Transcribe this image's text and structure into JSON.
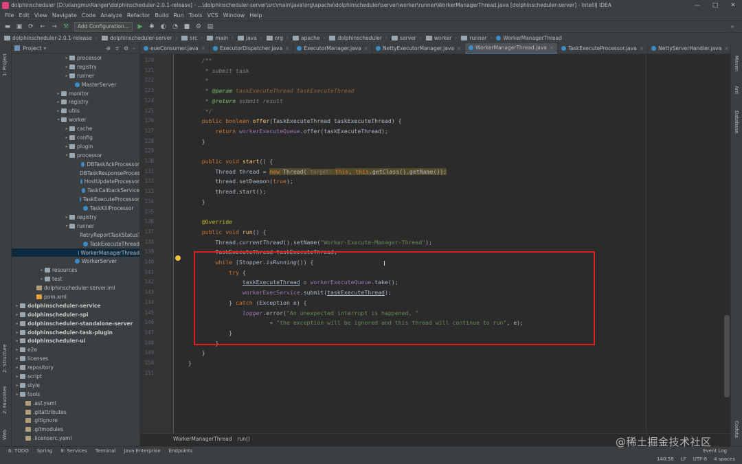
{
  "window": {
    "title": "dolphinscheduler [D:\\xiangmu\\Ranger\\dolphinscheduler-2.0.1-release] - ...\\dolphinscheduler-server\\src\\main\\java\\org\\apache\\dolphinscheduler\\server\\worker\\runner\\WorkerManagerThread.java [dolphinscheduler-server] - IntelliJ IDEA",
    "controls": [
      "—",
      "□",
      "✕"
    ]
  },
  "menu": [
    "File",
    "Edit",
    "View",
    "Navigate",
    "Code",
    "Analyze",
    "Refactor",
    "Build",
    "Run",
    "Tools",
    "VCS",
    "Window",
    "Help"
  ],
  "toolbar": {
    "config_label": "Add Configuration..."
  },
  "breadcrumb": [
    "dolphinscheduler-2.0.1-release",
    "dolphinscheduler-server",
    "src",
    "main",
    "java",
    "org",
    "apache",
    "dolphinscheduler",
    "server",
    "worker",
    "runner",
    "WorkerManagerThread"
  ],
  "side": {
    "project": "1: Project",
    "structure": "2: Structure",
    "favorites": "2: Favorites",
    "web": "Web",
    "maven": "Maven",
    "ant": "Ant",
    "database": "Database",
    "codota": "Codota"
  },
  "project": {
    "header": "Project",
    "tree": [
      {
        "label": "processor",
        "indent": 76,
        "icon": "folder",
        "arrow": "▸"
      },
      {
        "label": "registry",
        "indent": 76,
        "icon": "folder",
        "arrow": "▸"
      },
      {
        "label": "runner",
        "indent": 76,
        "icon": "folder",
        "arrow": "▸"
      },
      {
        "label": "MasterServer",
        "indent": 84,
        "icon": "cls",
        "arrow": ""
      },
      {
        "label": "monitor",
        "indent": 64,
        "icon": "folder",
        "arrow": "▸"
      },
      {
        "label": "registry",
        "indent": 64,
        "icon": "folder",
        "arrow": "▸"
      },
      {
        "label": "utils",
        "indent": 64,
        "icon": "folder",
        "arrow": "▸"
      },
      {
        "label": "worker",
        "indent": 64,
        "icon": "folder",
        "arrow": "▾"
      },
      {
        "label": "cache",
        "indent": 76,
        "icon": "folder",
        "arrow": "▸"
      },
      {
        "label": "config",
        "indent": 76,
        "icon": "folder",
        "arrow": "▸"
      },
      {
        "label": "plugin",
        "indent": 76,
        "icon": "folder",
        "arrow": "▸"
      },
      {
        "label": "processor",
        "indent": 76,
        "icon": "folder",
        "arrow": "▾"
      },
      {
        "label": "DBTaskAckProcessor",
        "indent": 96,
        "icon": "cls",
        "arrow": ""
      },
      {
        "label": "DBTaskResponseProcessor",
        "indent": 96,
        "icon": "cls",
        "arrow": ""
      },
      {
        "label": "HostUpdateProcessor",
        "indent": 96,
        "icon": "cls",
        "arrow": ""
      },
      {
        "label": "TaskCallbackService",
        "indent": 96,
        "icon": "cls",
        "arrow": ""
      },
      {
        "label": "TaskExecuteProcessor",
        "indent": 96,
        "icon": "cls",
        "arrow": ""
      },
      {
        "label": "TaskKillProcessor",
        "indent": 96,
        "icon": "cls",
        "arrow": ""
      },
      {
        "label": "registry",
        "indent": 76,
        "icon": "folder",
        "arrow": "▸"
      },
      {
        "label": "runner",
        "indent": 76,
        "icon": "folder",
        "arrow": "▾"
      },
      {
        "label": "RetryReportTaskStatusThread",
        "indent": 96,
        "icon": "cls",
        "arrow": ""
      },
      {
        "label": "TaskExecuteThread",
        "indent": 96,
        "icon": "cls",
        "arrow": ""
      },
      {
        "label": "WorkerManagerThread",
        "indent": 96,
        "icon": "cls",
        "arrow": "",
        "selected": true
      },
      {
        "label": "WorkerServer",
        "indent": 84,
        "icon": "cls",
        "arrow": ""
      },
      {
        "label": "resources",
        "indent": 40,
        "icon": "folder",
        "arrow": "▸"
      },
      {
        "label": "test",
        "indent": 40,
        "icon": "folder",
        "arrow": "▸"
      },
      {
        "label": "dolphinscheduler-server.iml",
        "indent": 28,
        "icon": "file",
        "arrow": ""
      },
      {
        "label": "pom.xml",
        "indent": 28,
        "icon": "xml",
        "arrow": ""
      },
      {
        "label": "dolphinscheduler-service",
        "indent": 4,
        "icon": "folder",
        "arrow": "▸",
        "bold": true
      },
      {
        "label": "dolphinscheduler-spi",
        "indent": 4,
        "icon": "folder",
        "arrow": "▸",
        "bold": true
      },
      {
        "label": "dolphinscheduler-standalone-server",
        "indent": 4,
        "icon": "folder",
        "arrow": "▸",
        "bold": true
      },
      {
        "label": "dolphinscheduler-task-plugin",
        "indent": 4,
        "icon": "folder",
        "arrow": "▸",
        "bold": true
      },
      {
        "label": "dolphinscheduler-ui",
        "indent": 4,
        "icon": "folder",
        "arrow": "▸",
        "bold": true
      },
      {
        "label": "e2e",
        "indent": 4,
        "icon": "folder",
        "arrow": "▸"
      },
      {
        "label": "licenses",
        "indent": 4,
        "icon": "folder",
        "arrow": "▸"
      },
      {
        "label": "repository",
        "indent": 4,
        "icon": "folder",
        "arrow": "▸"
      },
      {
        "label": "script",
        "indent": 4,
        "icon": "folder",
        "arrow": "▸"
      },
      {
        "label": "style",
        "indent": 4,
        "icon": "folder",
        "arrow": "▸"
      },
      {
        "label": "tools",
        "indent": 4,
        "icon": "folder",
        "arrow": "▸"
      },
      {
        "label": ".asf.yaml",
        "indent": 12,
        "icon": "file",
        "arrow": ""
      },
      {
        "label": ".gitattributes",
        "indent": 12,
        "icon": "file",
        "arrow": ""
      },
      {
        "label": ".gitignore",
        "indent": 12,
        "icon": "file",
        "arrow": ""
      },
      {
        "label": ".gitmodules",
        "indent": 12,
        "icon": "file",
        "arrow": ""
      },
      {
        "label": ".licenserc.yaml",
        "indent": 12,
        "icon": "file",
        "arrow": ""
      }
    ]
  },
  "tabs": [
    {
      "label": "eueConsumer.java"
    },
    {
      "label": "ExecutorDispatcher.java"
    },
    {
      "label": "ExecutorManager.java"
    },
    {
      "label": "NettyExecutorManager.java"
    },
    {
      "label": "WorkerManagerThread.java",
      "active": true
    },
    {
      "label": "TaskExecuteProcessor.java"
    },
    {
      "label": "NettyServerHandler.java"
    }
  ],
  "line_numbers": [
    "120",
    "121",
    "122",
    "123",
    "124",
    "125",
    "126",
    "127",
    "128",
    "129",
    "130",
    "131",
    "132",
    "133",
    "134",
    "135",
    "136",
    "137",
    "138",
    "139",
    "140",
    "141",
    "142",
    "143",
    "144",
    "145",
    "146",
    "147",
    "148",
    "149",
    "150",
    "151"
  ],
  "code_lines": [
    [
      {
        "t": "    /**",
        "c": "cm"
      }
    ],
    [
      {
        "t": "     * submit task",
        "c": "cm"
      }
    ],
    [
      {
        "t": "     *",
        "c": "cm"
      }
    ],
    [
      {
        "t": "     * ",
        "c": "cm"
      },
      {
        "t": "@param",
        "c": "tag"
      },
      {
        "t": " taskExecuteThread taskExecuteThread",
        "c": "prm"
      }
    ],
    [
      {
        "t": "     * ",
        "c": "cm"
      },
      {
        "t": "@return",
        "c": "tag"
      },
      {
        "t": " submit result",
        "c": "cm"
      }
    ],
    [
      {
        "t": "     */",
        "c": "cm"
      }
    ],
    [
      {
        "t": "    public boolean ",
        "c": "kw"
      },
      {
        "t": "offer",
        "c": "fn"
      },
      {
        "t": "(TaskExecuteThread taskExecuteThread) {"
      }
    ],
    [
      {
        "t": "        return ",
        "c": "kw"
      },
      {
        "t": "workerExecuteQueue",
        "c": "fld"
      },
      {
        "t": ".offer(taskExecuteThread);"
      }
    ],
    [
      {
        "t": "    }"
      }
    ],
    [
      {
        "t": ""
      }
    ],
    [
      {
        "t": "    public void ",
        "c": "kw"
      },
      {
        "t": "start",
        "c": "fn"
      },
      {
        "t": "() {"
      }
    ],
    [
      {
        "t": "        Thread thread = "
      },
      {
        "t": "new",
        "c": "kw hl"
      },
      {
        "t": " Thread( ",
        "c": "hl"
      },
      {
        "t": "target: ",
        "c": "hint hl"
      },
      {
        "t": "this",
        "c": "kw hl"
      },
      {
        "t": ", ",
        "c": "hl"
      },
      {
        "t": "this",
        "c": "kw hl"
      },
      {
        "t": ".getClass().getName());",
        "c": "hl"
      }
    ],
    [
      {
        "t": "        thread.setDaemon("
      },
      {
        "t": "true",
        "c": "kw"
      },
      {
        "t": ");"
      }
    ],
    [
      {
        "t": "        thread.start();"
      }
    ],
    [
      {
        "t": "    }"
      }
    ],
    [
      {
        "t": ""
      }
    ],
    [
      {
        "t": "    @Override",
        "c": "ann"
      }
    ],
    [
      {
        "t": "    public void ",
        "c": "kw"
      },
      {
        "t": "run",
        "c": "fn"
      },
      {
        "t": "() {"
      }
    ],
    [
      {
        "t": "        Thread."
      },
      {
        "t": "currentThread",
        "c": "ital"
      },
      {
        "t": "().setName("
      },
      {
        "t": "\"Worker-Execute-Manager-Thread\"",
        "c": "str"
      },
      {
        "t": ");"
      }
    ],
    [
      {
        "t": "        TaskExecuteThread taskExecuteThread;"
      }
    ],
    [
      {
        "t": "        while ",
        "c": "kw"
      },
      {
        "t": "(Stopper."
      },
      {
        "t": "isRunning",
        "c": "ital"
      },
      {
        "t": "()) {"
      }
    ],
    [
      {
        "t": "            try ",
        "c": "kw"
      },
      {
        "t": "{"
      }
    ],
    [
      {
        "t": "                "
      },
      {
        "t": "taskExecuteThread",
        "c": "ul"
      },
      {
        "t": " = "
      },
      {
        "t": "workerExecuteQueue",
        "c": "fld"
      },
      {
        "t": ".take();"
      }
    ],
    [
      {
        "t": "                "
      },
      {
        "t": "workerExecService",
        "c": "fld"
      },
      {
        "t": ".submit("
      },
      {
        "t": "taskExecuteThread",
        "c": "ul"
      },
      {
        "t": ");"
      }
    ],
    [
      {
        "t": "            } "
      },
      {
        "t": "catch ",
        "c": "kw"
      },
      {
        "t": "(Exception e) {"
      }
    ],
    [
      {
        "t": "                "
      },
      {
        "t": "logger",
        "c": "fld ital"
      },
      {
        "t": ".error("
      },
      {
        "t": "\"An unexpected interrupt is happened, \"",
        "c": "str"
      }
    ],
    [
      {
        "t": "                        + "
      },
      {
        "t": "\"the exception will be ignored and this thread will continue to run\"",
        "c": "str"
      },
      {
        "t": ", e);"
      }
    ],
    [
      {
        "t": "            }"
      }
    ],
    [
      {
        "t": "        }"
      }
    ],
    [
      {
        "t": "    }"
      }
    ],
    [
      {
        "t": "}"
      }
    ],
    [
      {
        "t": ""
      }
    ]
  ],
  "editor_breadcrumb": [
    "WorkerManagerThread",
    "run()"
  ],
  "toolwindows": [
    "6: TODO",
    "Spring",
    "8: Services",
    "Terminal",
    "Java Enterprise",
    "Endpoints",
    "Event Log"
  ],
  "status": [
    "140:58",
    "LF",
    "UTF-8",
    "4 spaces"
  ],
  "watermark": "@稀土掘金技术社区",
  "colors": {
    "highlight_box": "#e02020",
    "background": "#2b2b2b",
    "panel": "#3c3f41"
  }
}
